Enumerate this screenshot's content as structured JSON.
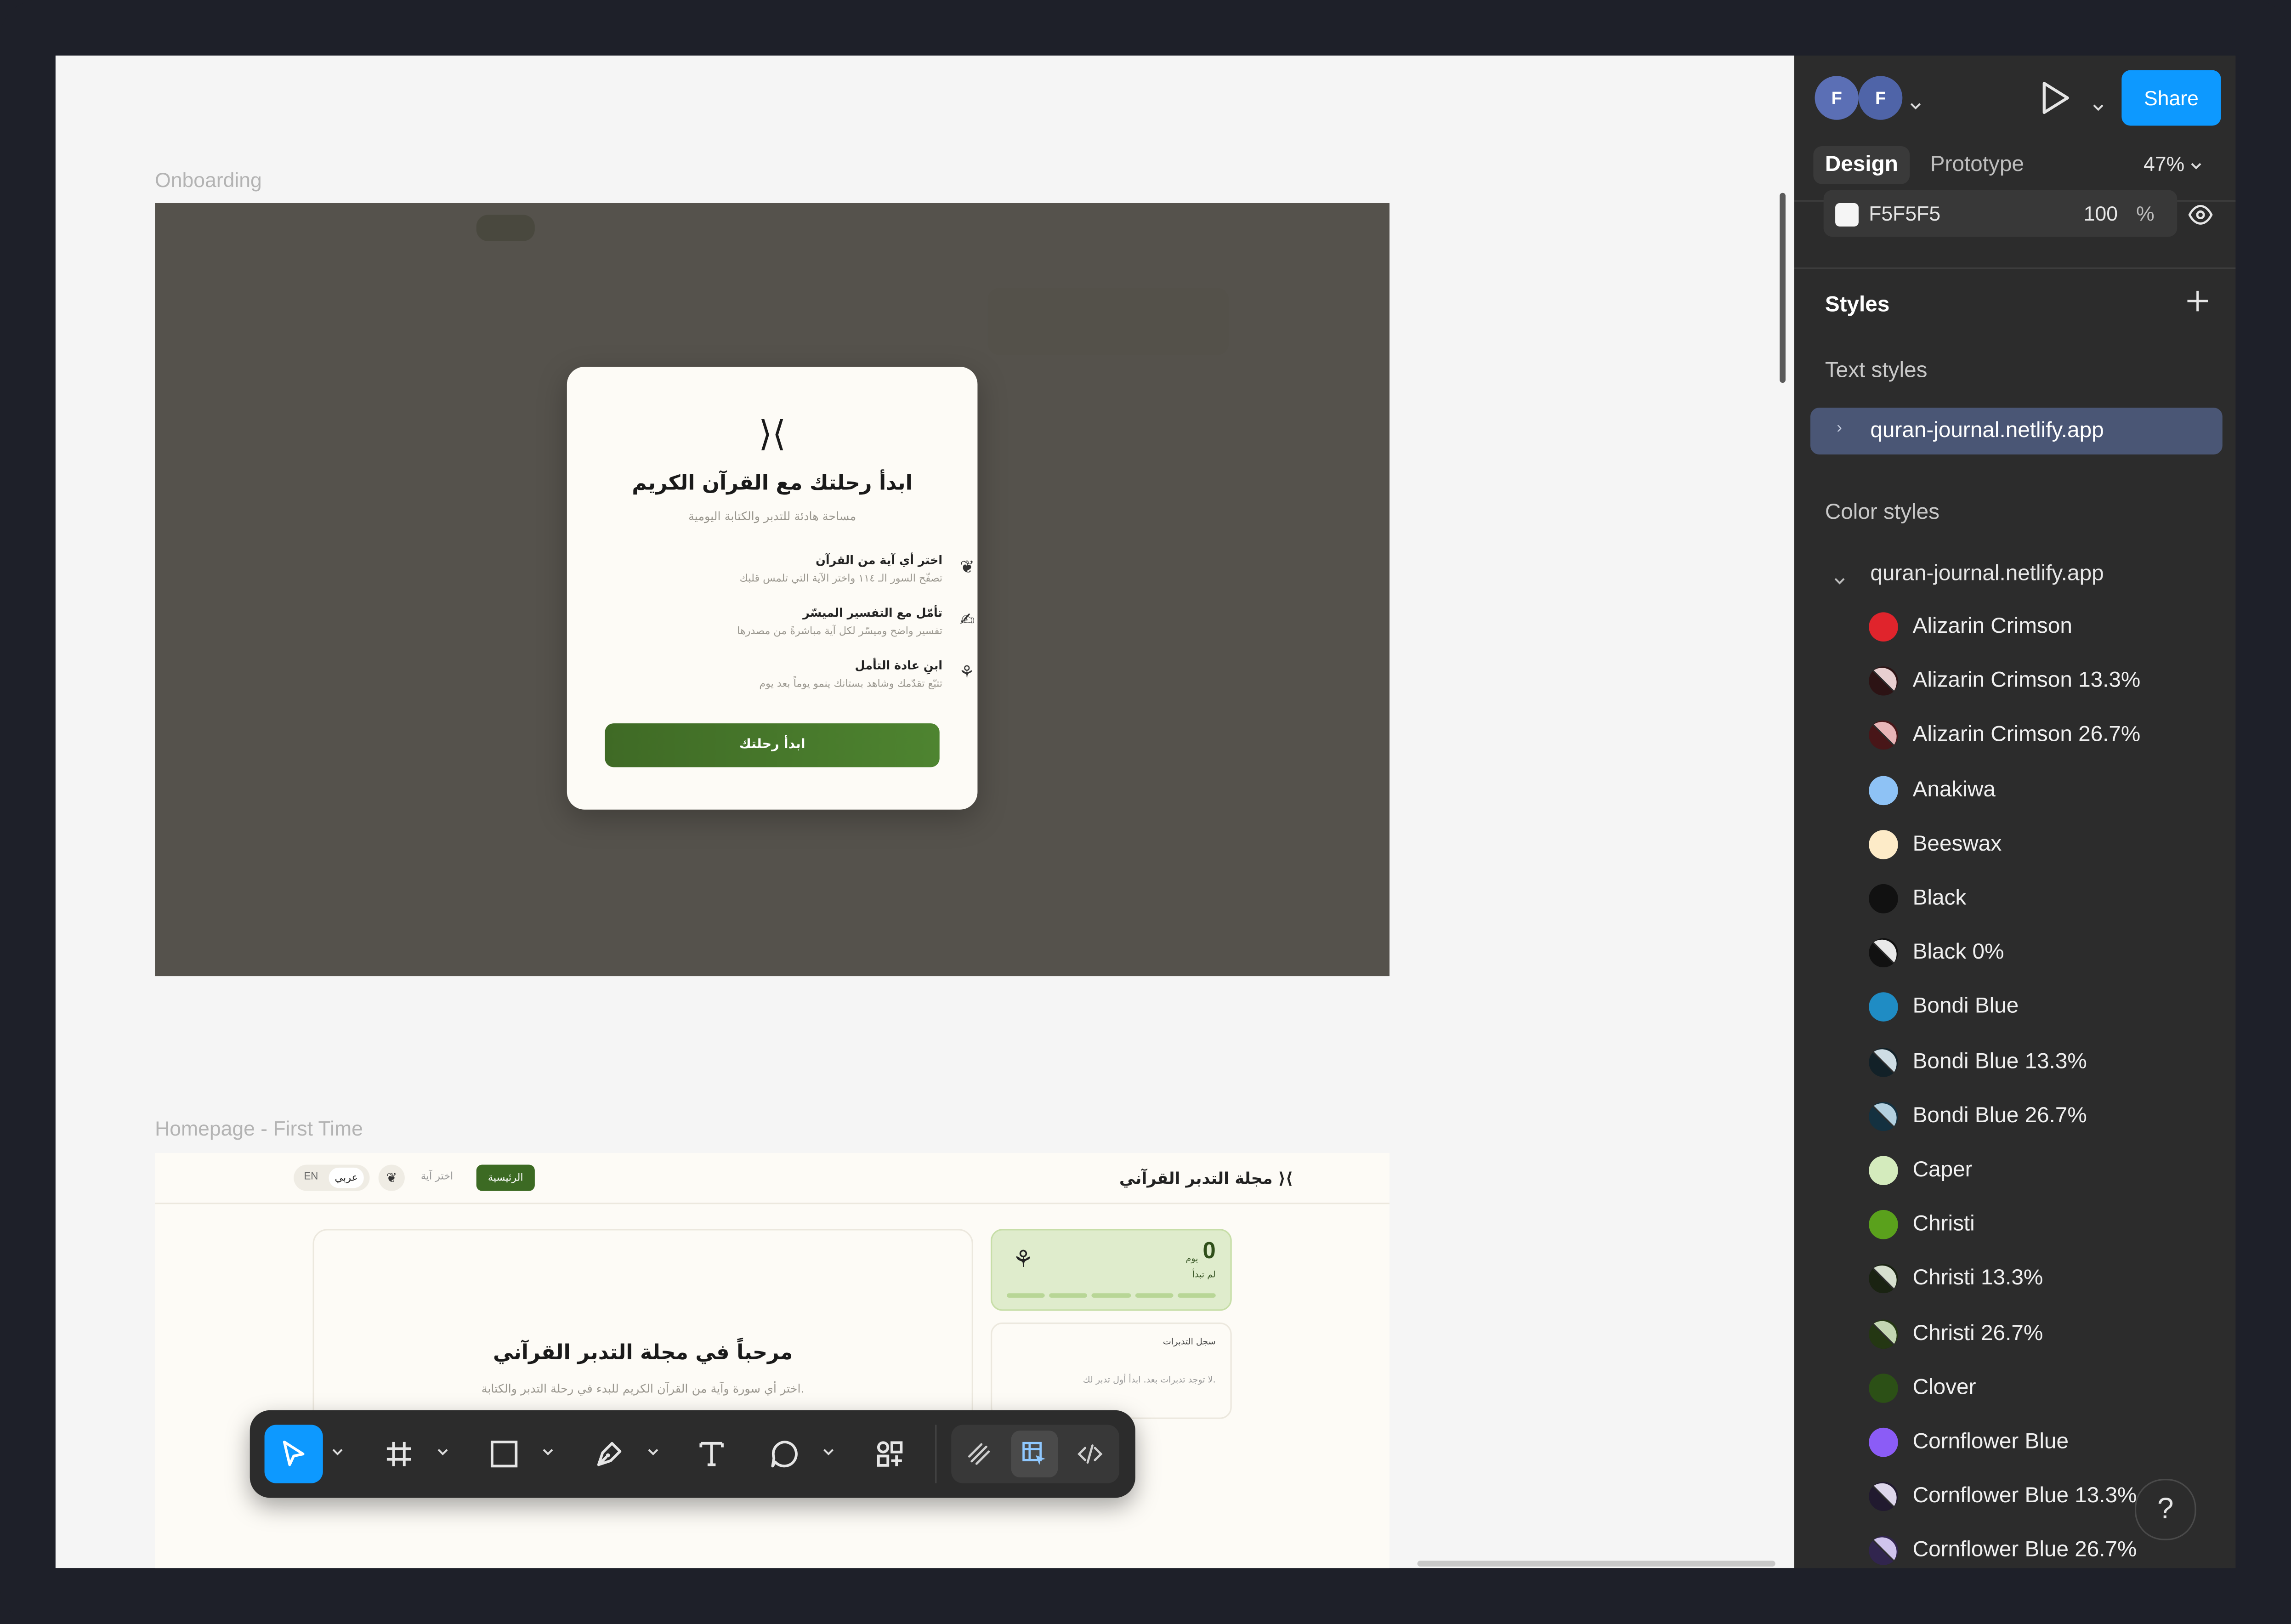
{
  "canvas": {
    "frames": [
      {
        "label": "Onboarding"
      },
      {
        "label": "Homepage - First Time"
      }
    ],
    "onboarding": {
      "logo": "⟩⟨",
      "title": "ابدأ رحلتك مع القرآن الكريم",
      "subtitle": "مساحة هادئة للتدبر والكتابة اليومية",
      "features": [
        {
          "title": "اختر أي آية من القرآن",
          "desc": "تصفّح السور الـ ١١٤ واختر الآية التي تلمس قلبك",
          "icon": "leaf-icon"
        },
        {
          "title": "تأمّل مع التفسير الميسّر",
          "desc": "تفسير واضح وميسّر لكل آية مباشرةً من مصدرها",
          "icon": "writing-hand-icon"
        },
        {
          "title": "ابنِ عادة التأمل",
          "desc": "تتبّع تقدّمك وشاهد بستانك ينمو يوماً بعد يوم",
          "icon": "sprout-icon"
        }
      ],
      "button": "ابدأ رحلتك"
    },
    "homepage": {
      "title": "مجلة التدبر القرآني",
      "logo": "⟩⟨",
      "nav_home": "الرئيسية",
      "nav_pick": "اختر آية",
      "lang_en": "EN",
      "lang_ar": "عربي",
      "welcome": "مرحباً في مجلة التدبر القرآني",
      "welcome_sub": "اختر أي سورة وآية من القرآن الكريم للبدء في رحلة التدبر والكتابة.",
      "streak_number": "0",
      "streak_unit": "يوم",
      "streak_status": "لم تبدأ",
      "log_title": "سجل التدبرات",
      "log_empty": "لا توجد تدبرات بعد. ابدأ أول تدبر لك."
    }
  },
  "toolbar": {
    "tools": [
      "move-tool",
      "frame-tool",
      "shape-tool",
      "pen-tool",
      "text-tool",
      "comment-tool",
      "actions-tool"
    ],
    "modes": [
      "draw-mode",
      "design-mode",
      "dev-mode"
    ]
  },
  "panel": {
    "avatars": [
      "F",
      "F"
    ],
    "share_label": "Share",
    "tabs": [
      "Design",
      "Prototype"
    ],
    "zoom": "47%",
    "fill": {
      "hex": "F5F5F5",
      "opacity": "100",
      "unit": "%"
    },
    "styles_title": "Styles",
    "text_styles_title": "Text styles",
    "text_style_library": "quran-journal.netlify.app",
    "color_styles_title": "Color styles",
    "color_style_library": "quran-journal.netlify.app",
    "colors": [
      {
        "name": "Alizarin Crimson",
        "hex": "#e0242c",
        "alpha": 1
      },
      {
        "name": "Alizarin Crimson 13.3%",
        "hex": "#e0242c",
        "alpha": 0.133
      },
      {
        "name": "Alizarin Crimson 26.7%",
        "hex": "#e0242c",
        "alpha": 0.267
      },
      {
        "name": "Anakiwa",
        "hex": "#8ec2f5",
        "alpha": 1
      },
      {
        "name": "Beeswax",
        "hex": "#fdebc8",
        "alpha": 1
      },
      {
        "name": "Black",
        "hex": "#111111",
        "alpha": 1
      },
      {
        "name": "Black 0%",
        "hex": "#111111",
        "alpha": 0
      },
      {
        "name": "Bondi Blue",
        "hex": "#1f8cc4",
        "alpha": 1
      },
      {
        "name": "Bondi Blue 13.3%",
        "hex": "#1f8cc4",
        "alpha": 0.133
      },
      {
        "name": "Bondi Blue 26.7%",
        "hex": "#1f8cc4",
        "alpha": 0.267
      },
      {
        "name": "Caper",
        "hex": "#d4ebbd",
        "alpha": 1
      },
      {
        "name": "Christi",
        "hex": "#5aa11c",
        "alpha": 1
      },
      {
        "name": "Christi 13.3%",
        "hex": "#5aa11c",
        "alpha": 0.133
      },
      {
        "name": "Christi 26.7%",
        "hex": "#5aa11c",
        "alpha": 0.267
      },
      {
        "name": "Clover",
        "hex": "#2c5016",
        "alpha": 1
      },
      {
        "name": "Cornflower Blue",
        "hex": "#8b5cf6",
        "alpha": 1
      },
      {
        "name": "Cornflower Blue 13.3%",
        "hex": "#8b5cf6",
        "alpha": 0.133
      },
      {
        "name": "Cornflower Blue 26.7%",
        "hex": "#8b5cf6",
        "alpha": 0.267
      }
    ],
    "help": "?"
  },
  "accent": "#0d99ff"
}
